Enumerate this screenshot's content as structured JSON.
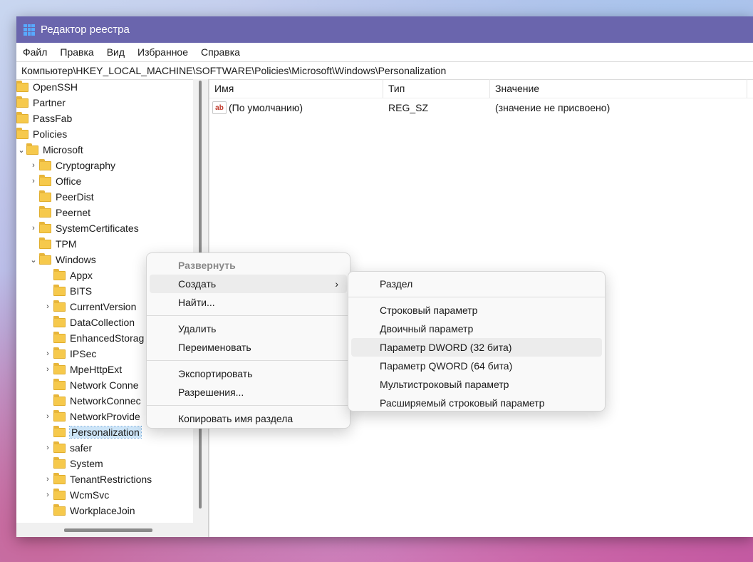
{
  "window": {
    "title": "Редактор реестра"
  },
  "menubar": [
    "Файл",
    "Правка",
    "Вид",
    "Избранное",
    "Справка"
  ],
  "address": "Компьютер\\HKEY_LOCAL_MACHINE\\SOFTWARE\\Policies\\Microsoft\\Windows\\Personalization",
  "tree": [
    {
      "label": "OpenSSH"
    },
    {
      "label": "Partner"
    },
    {
      "label": "PassFab"
    },
    {
      "label": "Policies"
    },
    {
      "label": "Microsoft"
    },
    {
      "label": "Cryptography"
    },
    {
      "label": "Office"
    },
    {
      "label": "PeerDist"
    },
    {
      "label": "Peernet"
    },
    {
      "label": "SystemCertificates"
    },
    {
      "label": "TPM"
    },
    {
      "label": "Windows"
    },
    {
      "label": "Appx"
    },
    {
      "label": "BITS"
    },
    {
      "label": "CurrentVersion"
    },
    {
      "label": "DataCollection"
    },
    {
      "label": "EnhancedStorag"
    },
    {
      "label": "IPSec"
    },
    {
      "label": "MpeHttpExt"
    },
    {
      "label": "Network Conne"
    },
    {
      "label": "NetworkConnec"
    },
    {
      "label": "NetworkProvide"
    },
    {
      "label": "Personalization"
    },
    {
      "label": "safer"
    },
    {
      "label": "System"
    },
    {
      "label": "TenantRestrictions"
    },
    {
      "label": "WcmSvc"
    },
    {
      "label": "WorkplaceJoin"
    }
  ],
  "columns": {
    "name": "Имя",
    "type": "Тип",
    "value": "Значение"
  },
  "values": [
    {
      "name": "(По умолчанию)",
      "type": "REG_SZ",
      "data": "(значение не присвоено)",
      "icon_text": "ab"
    }
  ],
  "context_menu": [
    "Развернуть",
    "Создать",
    "Найти...",
    "Удалить",
    "Переименовать",
    "Экспортировать",
    "Разрешения...",
    "Копировать имя раздела"
  ],
  "submenu": [
    "Раздел",
    "Строковый параметр",
    "Двоичный параметр",
    "Параметр DWORD (32 бита)",
    "Параметр QWORD (64 бита)",
    "Мультистроковый параметр",
    "Расширяемый строковый параметр"
  ],
  "colors": {
    "titlebar": "#6a65ad",
    "folder": "#f6c94c",
    "selection": "#cce4f7"
  }
}
